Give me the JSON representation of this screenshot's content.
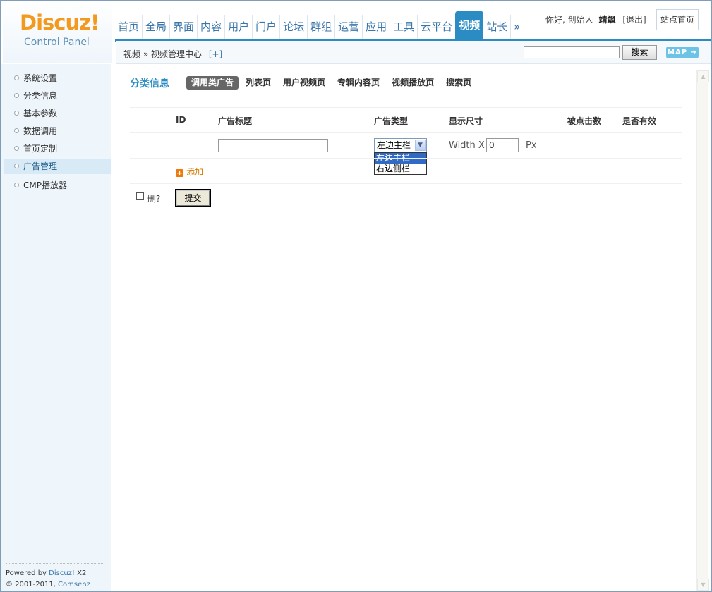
{
  "header": {
    "logo": "Discuz!",
    "logo_sub": "Control Panel",
    "nav": [
      "首页",
      "全局",
      "界面",
      "内容",
      "用户",
      "门户",
      "论坛",
      "群组",
      "运营",
      "应用",
      "工具",
      "云平台",
      "视频",
      "站长",
      "»"
    ],
    "active_nav": "视频",
    "greeting": "你好, 创始人",
    "username": "靖飒",
    "logout": "[退出]",
    "site_home": "站点首页"
  },
  "subbar": {
    "breadcrumb": "视频 » 视频管理中心",
    "add": "[+]",
    "search_value": "",
    "search_btn": "搜索",
    "map_btn": "MAP ➔"
  },
  "sidebar": {
    "items": [
      "系统设置",
      "分类信息",
      "基本参数",
      "数据调用",
      "首页定制",
      "广告管理",
      "CMP播放器"
    ],
    "active": "广告管理",
    "footer_line1_a": "Powered by ",
    "footer_line1_b": "Discuz!",
    "footer_line1_c": " X2",
    "footer_line2_a": "© 2001-2011, ",
    "footer_line2_b": "Comsenz Inc."
  },
  "main": {
    "section_title": "分类信息",
    "tabs": [
      "调用类广告",
      "列表页",
      "用户视频页",
      "专辑内容页",
      "视频播放页",
      "搜索页"
    ],
    "active_tab": "调用类广告",
    "headers": {
      "id": "ID",
      "title": "广告标题",
      "type": "广告类型",
      "size": "显示尺寸",
      "clicks": "被点击数",
      "valid": "是否有效"
    },
    "row": {
      "title_value": "",
      "type_selected": "左边主栏",
      "type_options": [
        "左边主栏",
        "右边侧栏"
      ],
      "width_label": "Width X",
      "width_value": "0",
      "px_label": "Px"
    },
    "add_label": "添加",
    "delete_label": "删?",
    "submit_label": "提交"
  }
}
